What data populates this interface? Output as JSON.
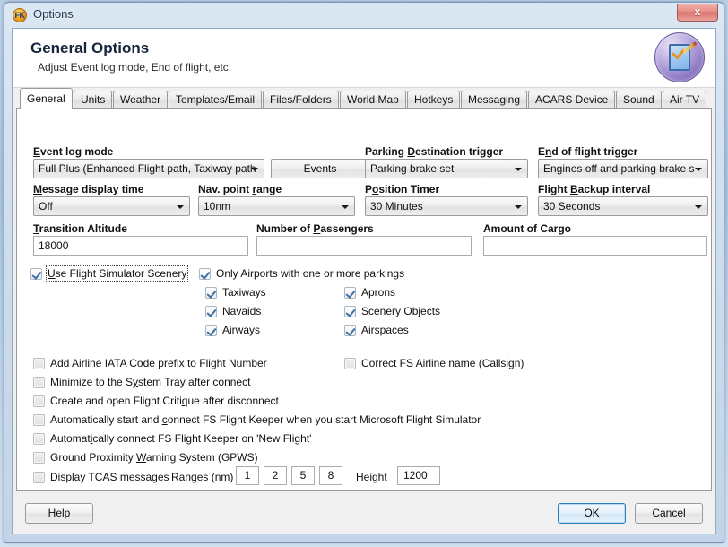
{
  "window": {
    "title": "Options",
    "icon_label": "FK",
    "close_label": "x"
  },
  "banner": {
    "title": "General Options",
    "subtitle": "Adjust Event log mode, End of flight, etc."
  },
  "tabs": [
    {
      "label": "General",
      "active": true
    },
    {
      "label": "Units",
      "active": false
    },
    {
      "label": "Weather",
      "active": false
    },
    {
      "label": "Templates/Email",
      "active": false
    },
    {
      "label": "Files/Folders",
      "active": false
    },
    {
      "label": "World Map",
      "active": false
    },
    {
      "label": "Hotkeys",
      "active": false
    },
    {
      "label": "Messaging",
      "active": false
    },
    {
      "label": "ACARS Device",
      "active": false
    },
    {
      "label": "Sound",
      "active": false
    },
    {
      "label": "Air TV",
      "active": false
    }
  ],
  "fields": {
    "event_log_mode": {
      "label_pre": "",
      "accel": "E",
      "label_post": "vent log mode",
      "value": "Full Plus (Enhanced Flight path, Taxiway path"
    },
    "events_button": {
      "label": "Events"
    },
    "parking_trigger": {
      "label_pre": "Parking ",
      "accel": "D",
      "label_post": "estination trigger",
      "value": "Parking brake set"
    },
    "end_flight_trigger": {
      "label_pre": "E",
      "accel": "n",
      "label_post": "d of flight trigger",
      "value": "Engines off and parking brake s"
    },
    "message_display": {
      "label_pre": "",
      "accel": "M",
      "label_post": "essage display time",
      "value": "Off"
    },
    "nav_point_range": {
      "label_pre": "Nav. point ",
      "accel": "r",
      "label_post": "ange",
      "value": "10nm"
    },
    "position_timer": {
      "label_pre": "P",
      "accel": "o",
      "label_post": "sition Timer",
      "value": "30 Minutes"
    },
    "flight_backup": {
      "label_pre": "Flight ",
      "accel": "B",
      "label_post": "ackup interval",
      "value": "30 Seconds"
    },
    "transition_alt": {
      "label_pre": "",
      "accel": "T",
      "label_post": "ransition Altitude",
      "value": "18000"
    },
    "num_passengers": {
      "label_pre": "Number of ",
      "accel": "P",
      "label_post": "assengers",
      "value": ""
    },
    "amount_cargo": {
      "label_pre": "Amount of Cargo",
      "accel": "",
      "label_post": "",
      "value": ""
    }
  },
  "scenery": {
    "use_fs_scenery": {
      "label_pre": "",
      "accel": "U",
      "label_post": "se Flight Simulator Scenery",
      "checked": true,
      "focused": true
    },
    "only_airports": {
      "label": "Only Airports with one or more parkings",
      "checked": true
    },
    "taxiways": {
      "label": "Taxiways",
      "checked": true
    },
    "navaids": {
      "label": "Navaids",
      "checked": true
    },
    "airways": {
      "label": "Airways",
      "checked": true
    },
    "aprons": {
      "label": "Aprons",
      "checked": true
    },
    "scenery_objects": {
      "label": "Scenery Objects",
      "checked": true
    },
    "airspaces": {
      "label": "Airspaces",
      "checked": true
    }
  },
  "options": [
    {
      "key": "iata_prefix",
      "label_pre": "Add Airline IATA Code prefix to Flight Number",
      "accel": "",
      "label_post": "",
      "checked": false
    },
    {
      "key": "minimize_tray",
      "label_pre": "Minimize to the S",
      "accel": "y",
      "label_post": "stem Tray after connect",
      "checked": false
    },
    {
      "key": "flight_critique",
      "label_pre": "Create and open Flight Criti",
      "accel": "q",
      "label_post": "ue after disconnect",
      "checked": false
    },
    {
      "key": "auto_start",
      "label_pre": "Automatically start and ",
      "accel": "c",
      "label_post": "onnect FS Flight Keeper when you start Microsoft Flight Simulator",
      "checked": false
    },
    {
      "key": "auto_newflight",
      "label_pre": "Automat",
      "accel": "i",
      "label_post": "cally connect FS Flight Keeper on 'New Flight'",
      "checked": false
    },
    {
      "key": "gpws",
      "label_pre": "Ground Proximity ",
      "accel": "W",
      "label_post": "arning System (GPWS)",
      "checked": false
    },
    {
      "key": "tcas",
      "label_pre": "Display TCA",
      "accel": "S",
      "label_post": " messages",
      "checked": false
    }
  ],
  "correct_callsign": {
    "label": "Correct FS Airline name (Callsign)",
    "checked": false
  },
  "tcas": {
    "ranges_label": "Ranges (nm)",
    "ranges": [
      "1",
      "2",
      "5",
      "8"
    ],
    "height_label": "Height",
    "height_value": "1200"
  },
  "buttons": {
    "help": "Help",
    "ok": "OK",
    "cancel": "Cancel"
  }
}
